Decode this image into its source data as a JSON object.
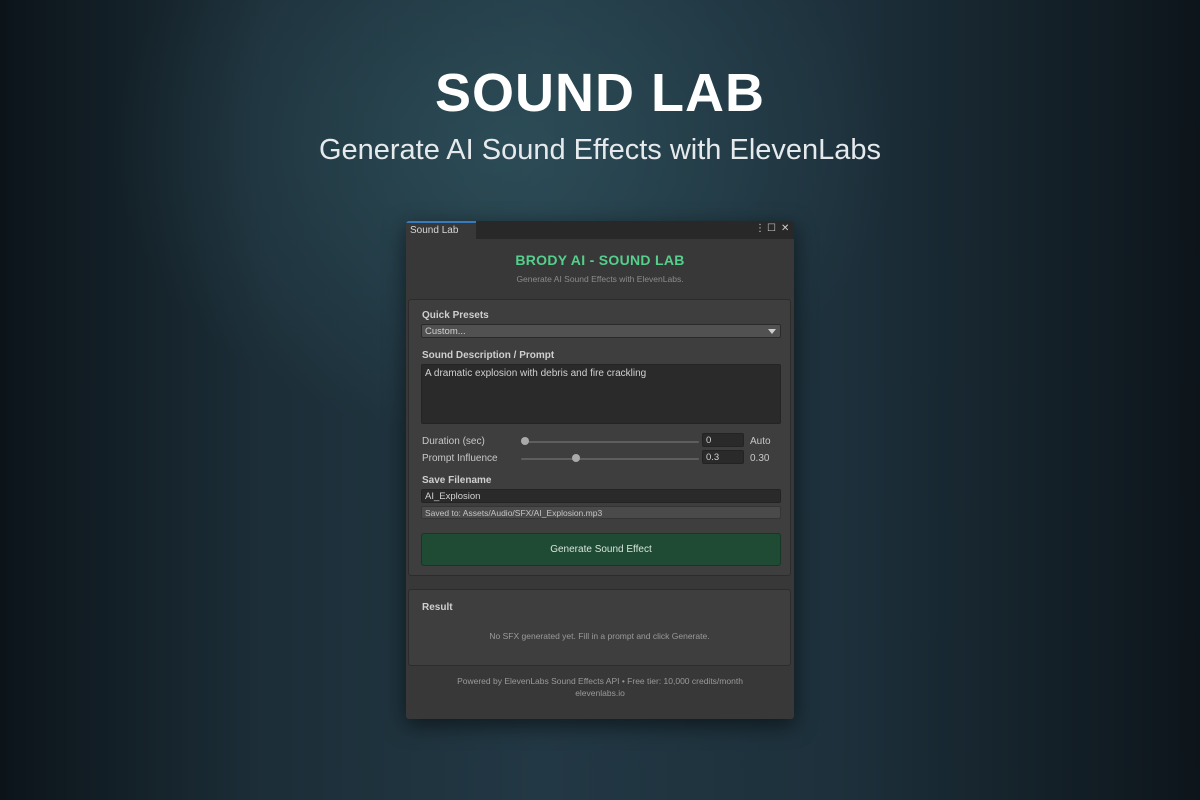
{
  "hero": {
    "title": "SOUND LAB",
    "subtitle": "Generate AI Sound Effects with ElevenLabs"
  },
  "window": {
    "tab_label": "Sound Lab",
    "controls": {
      "menu": "⋮",
      "maximize": "☐",
      "close": "✕"
    }
  },
  "header": {
    "title": "BRODY AI - SOUND LAB",
    "subtitle": "Generate AI Sound Effects with ElevenLabs."
  },
  "form": {
    "presets_label": "Quick Presets",
    "preset_value": "Custom...",
    "prompt_label": "Sound Description / Prompt",
    "prompt_value": "A dramatic explosion with debris and fire crackling",
    "duration": {
      "label": "Duration (sec)",
      "field": "0",
      "value_text": "Auto",
      "fraction": 0.0
    },
    "influence": {
      "label": "Prompt Influence",
      "field": "0.3",
      "value_text": "0.30",
      "fraction": 0.3
    },
    "filename_label": "Save Filename",
    "filename_value": "AI_Explosion",
    "saved_path": "Saved to: Assets/Audio/SFX/AI_Explosion.mp3",
    "generate_button": "Generate Sound Effect"
  },
  "result": {
    "label": "Result",
    "message": "No SFX generated yet. Fill in a prompt and click Generate."
  },
  "footer": {
    "line1": "Powered by ElevenLabs Sound Effects API  •  Free tier: 10,000 credits/month",
    "line2": "elevenlabs.io"
  },
  "colors": {
    "accent_green": "#54d08c",
    "button_green": "#1f4a34",
    "tab_highlight": "#3a79bb"
  }
}
